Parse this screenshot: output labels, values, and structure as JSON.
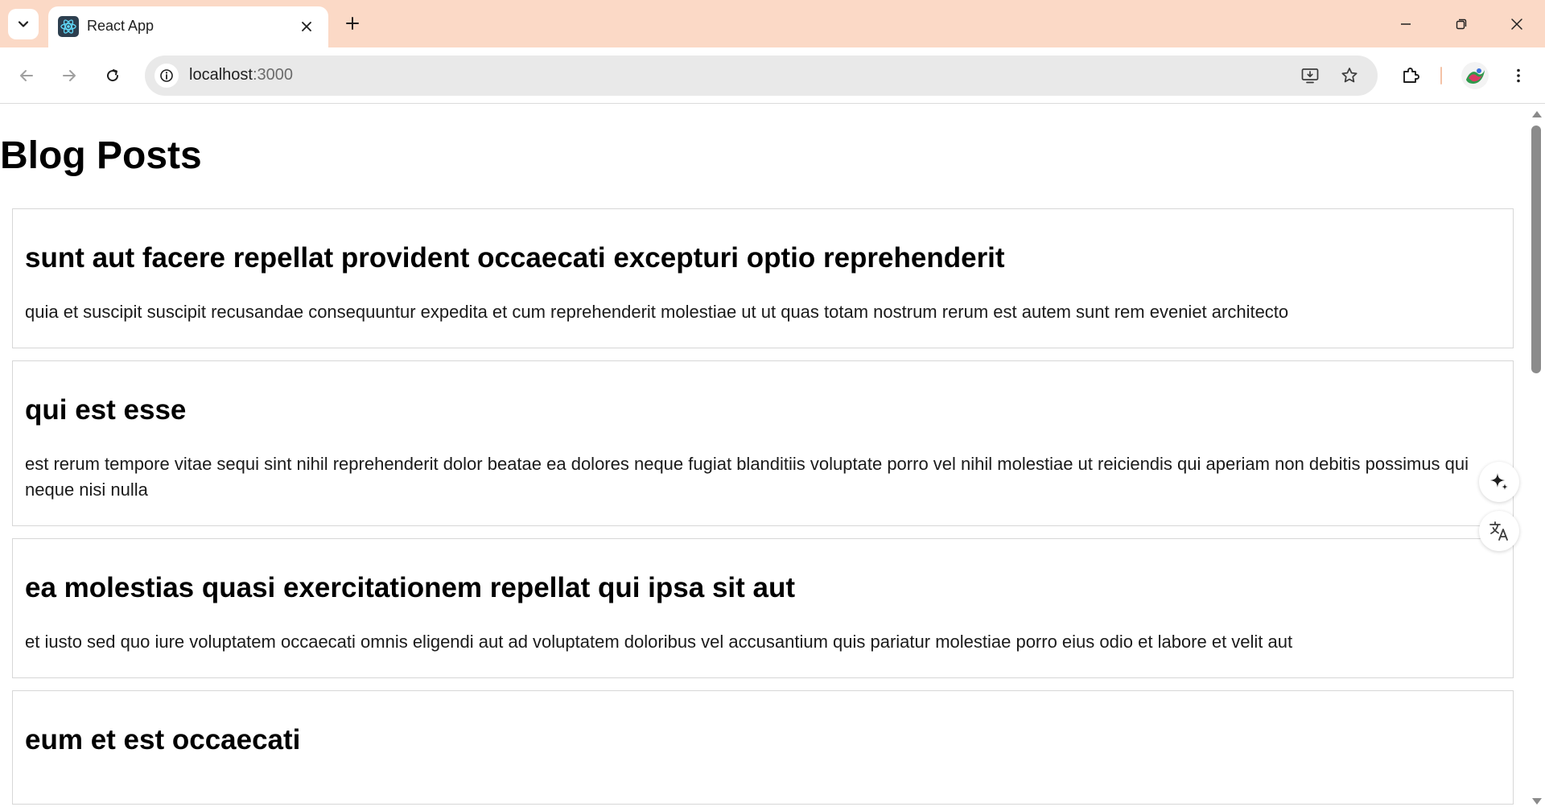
{
  "browser": {
    "tab_title": "React App",
    "url_host": "localhost",
    "url_port": ":3000",
    "icons": {
      "tab_search": "chevron-down-icon",
      "favicon": "react-logo-icon",
      "close": "close-icon",
      "new_tab": "plus-icon",
      "minimize": "minimize-icon",
      "restore": "restore-icon",
      "window_close": "close-icon",
      "back": "arrow-left-icon",
      "forward": "arrow-right-icon",
      "reload": "reload-icon",
      "site_info": "info-icon",
      "install": "install-app-icon",
      "bookmark": "star-icon",
      "extensions": "puzzle-icon",
      "profile": "avatar",
      "menu": "kebab-menu-icon"
    },
    "colors": {
      "tabstrip": "#fbd9c6",
      "omnibox": "#e9e9e9"
    }
  },
  "page": {
    "title": "Blog Posts",
    "posts": [
      {
        "title": "sunt aut facere repellat provident occaecati excepturi optio reprehenderit",
        "body": "quia et suscipit suscipit recusandae consequuntur expedita et cum reprehenderit molestiae ut ut quas totam nostrum rerum est autem sunt rem eveniet architecto"
      },
      {
        "title": "qui est esse",
        "body": "est rerum tempore vitae sequi sint nihil reprehenderit dolor beatae ea dolores neque fugiat blanditiis voluptate porro vel nihil molestiae ut reiciendis qui aperiam non debitis possimus qui neque nisi nulla"
      },
      {
        "title": "ea molestias quasi exercitationem repellat qui ipsa sit aut",
        "body": "et iusto sed quo iure voluptatem occaecati omnis eligendi aut ad voluptatem doloribus vel accusantium quis pariatur molestiae porro eius odio et labore et velit aut"
      },
      {
        "title": "eum et est occaecati",
        "body": ""
      }
    ],
    "floating_buttons": [
      "sparkle-icon",
      "translate-icon"
    ]
  }
}
